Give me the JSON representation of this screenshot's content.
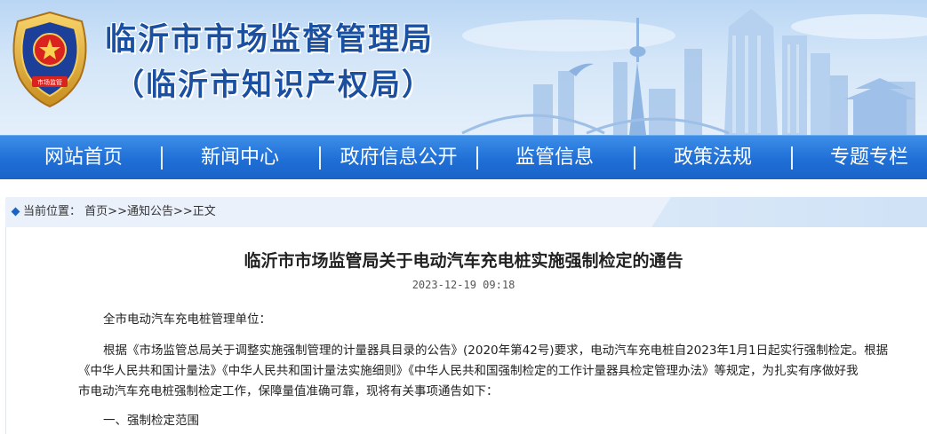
{
  "header": {
    "title": "临沂市市场监督管理局",
    "subtitle": "（临沂市知识产权局）",
    "emblem_text": "市场监管"
  },
  "nav": {
    "items": [
      {
        "label": "网站首页"
      },
      {
        "label": "新闻中心"
      },
      {
        "label": "政府信息公开"
      },
      {
        "label": "监管信息"
      },
      {
        "label": "政策法规"
      },
      {
        "label": "专题专栏"
      }
    ]
  },
  "breadcrumb": {
    "prefix": "当前位置：",
    "home": "首页",
    "sep1": ">>",
    "section": "通知公告",
    "sep2": ">>",
    "current": "正文"
  },
  "article": {
    "title": "临沂市市场监管局关于电动汽车充电桩实施强制检定的通告",
    "date": "2023-12-19 09:18",
    "salutation": "全市电动汽车充电桩管理单位：",
    "body_line1": "根据《市场监管总局关于调整实施强制管理的计量器具目录的公告》(2020年第42号)要求，电动汽车充电桩自2023年1月1日起实行强制检定。根据",
    "body_line2": "《中华人民共和国计量法》《中华人民共和国计量法实施细则》《中华人民共和国强制检定的工作计量器具检定管理办法》等规定，为扎实有序做好我",
    "body_line3": "市电动汽车充电桩强制检定工作，保障量值准确可靠，现将有关事项通告如下：",
    "section1": "一、强制检定范围"
  },
  "colors": {
    "nav_blue": "#1f6fd6",
    "title_blue": "#1b4fa0",
    "crumb_bg": "#eaf1fb"
  }
}
